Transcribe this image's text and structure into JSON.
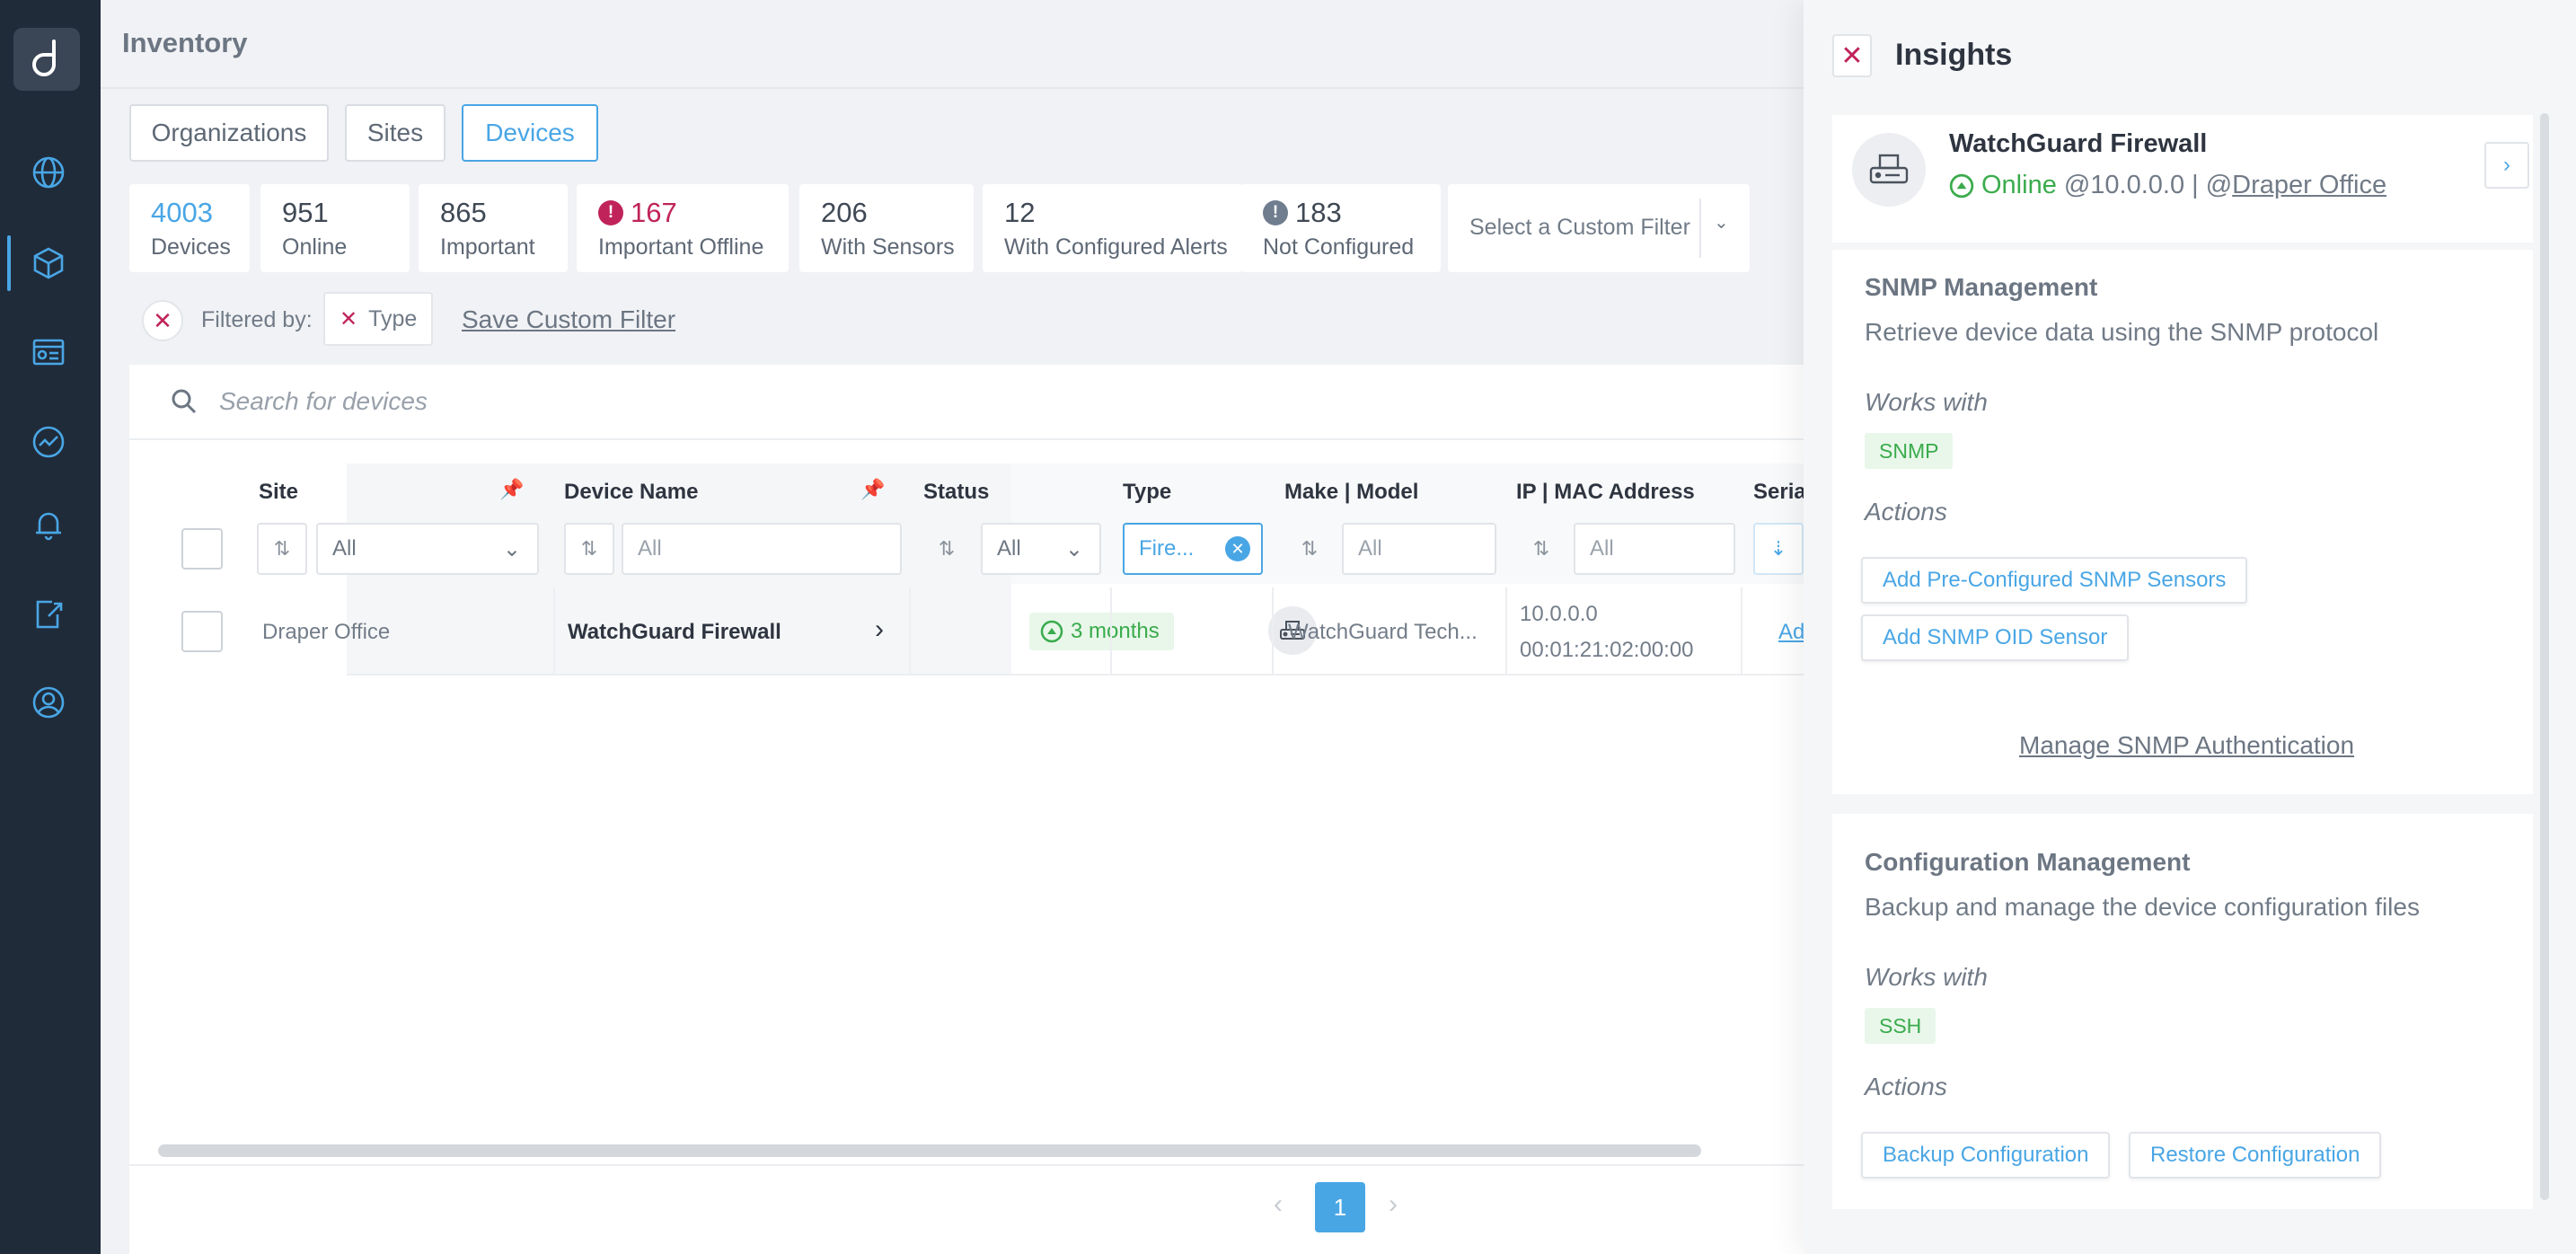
{
  "app": {
    "title": "Inventory"
  },
  "sidebar": {
    "logo": "d",
    "items": [
      {
        "icon": "globe-icon"
      },
      {
        "icon": "cube-icon",
        "active": true
      },
      {
        "icon": "dashboard-icon"
      },
      {
        "icon": "monitoring-icon"
      },
      {
        "icon": "bell-icon"
      },
      {
        "icon": "export-icon"
      },
      {
        "icon": "user-circle-icon"
      }
    ]
  },
  "tabs": [
    "Organizations",
    "Sites",
    "Devices"
  ],
  "active_tab": "Devices",
  "stats": [
    {
      "value": "4003",
      "label": "Devices"
    },
    {
      "value": "951",
      "label": "Online"
    },
    {
      "value": "865",
      "label": "Important"
    },
    {
      "value": "167",
      "label": "Important Offline"
    },
    {
      "value": "206",
      "label": "With Sensors"
    },
    {
      "value": "12",
      "label": "With Configured Alerts"
    },
    {
      "value": "183",
      "label": "Not Configured"
    }
  ],
  "custom_filter": {
    "placeholder": "Select a Custom Filter"
  },
  "filters": {
    "filtered_by": "Filtered by:",
    "chip": "Type",
    "save": "Save Custom Filter"
  },
  "search": {
    "placeholder": "Search for devices"
  },
  "table": {
    "columns": [
      "Site",
      "Device Name",
      "Status",
      "Type",
      "Make | Model",
      "IP | MAC Address",
      "Seria"
    ],
    "filters": {
      "site": "All",
      "device_name": "All",
      "status": "All",
      "type": "Fire...",
      "make_model": "All",
      "ip_mac": "All"
    },
    "rows": [
      {
        "site": "Draper Office",
        "device_name": "WatchGuard Firewall",
        "status": "3 months",
        "make_model": "WatchGuard Tech...",
        "ip": "10.0.0.0",
        "mac": "00:01:21:02:00:00",
        "serial": "Ad"
      }
    ]
  },
  "pagination": {
    "current": "1"
  },
  "insights": {
    "title": "Insights",
    "device": {
      "name": "WatchGuard Firewall",
      "status": "Online",
      "ip": "@10.0.0.0 | @",
      "site": "Draper Office"
    },
    "snmp": {
      "heading": "SNMP Management",
      "description": "Retrieve device data using the SNMP protocol",
      "works_with_label": "Works with",
      "works_with": "SNMP",
      "actions_label": "Actions",
      "actions": [
        "Add Pre-Configured SNMP Sensors",
        "Add SNMP OID Sensor"
      ],
      "link": "Manage SNMP Authentication"
    },
    "config": {
      "heading": "Configuration Management",
      "description": "Backup and manage the device configuration files",
      "works_with_label": "Works with",
      "works_with": "SSH",
      "actions_label": "Actions",
      "actions": [
        "Backup Configuration",
        "Restore Configuration"
      ]
    }
  },
  "colors": {
    "accent": "#49a6e5",
    "alert": "#c0235a",
    "success": "#3aab4c",
    "sidebar": "#202b3a"
  }
}
